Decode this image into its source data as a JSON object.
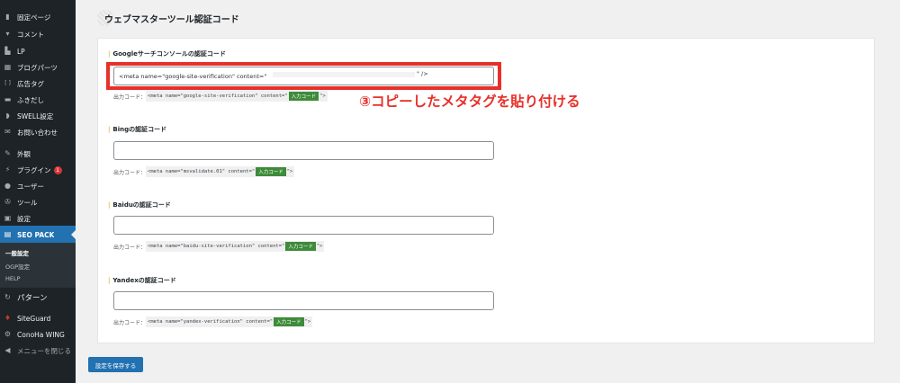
{
  "sidebar": {
    "items": [
      {
        "label": "固定ページ",
        "icon": "page-icon"
      },
      {
        "label": "コメント",
        "icon": "comment-icon"
      },
      {
        "label": "LP",
        "icon": "document-icon"
      },
      {
        "label": "ブログパーツ",
        "icon": "blocks-icon"
      },
      {
        "label": "広告タグ",
        "icon": "ad-tag-icon"
      },
      {
        "label": "ふきだし",
        "icon": "speech-bubble-icon"
      },
      {
        "label": "SWELL設定",
        "icon": "swell-icon"
      },
      {
        "label": "お問い合わせ",
        "icon": "mail-icon"
      },
      {
        "label": "外観",
        "icon": "appearance-icon"
      },
      {
        "label": "プラグイン",
        "icon": "plugin-icon",
        "badge": "1"
      },
      {
        "label": "ユーザー",
        "icon": "user-icon"
      },
      {
        "label": "ツール",
        "icon": "tools-icon"
      },
      {
        "label": "設定",
        "icon": "settings-icon"
      },
      {
        "label": "SEO PACK",
        "icon": "seo-pack-icon",
        "current": true
      },
      {
        "label": "パターン",
        "icon": "pattern-icon"
      },
      {
        "label": "SiteGuard",
        "icon": "siteguard-icon"
      },
      {
        "label": "ConoHa WING",
        "icon": "gear-icon"
      },
      {
        "label": "メニューを閉じる",
        "icon": "collapse-icon"
      }
    ],
    "submenu": [
      {
        "label": "一般設定",
        "active": true
      },
      {
        "label": "OGP設定"
      },
      {
        "label": "HELP"
      }
    ]
  },
  "page": {
    "title": "ウェブマスターツール認証コード"
  },
  "fields": [
    {
      "label": "Googleサーチコンソールの認証コード",
      "value": "<meta name=\"google-site-verification\" content=\"",
      "value_suffix": "\" />",
      "output_prefix": "出力コード：",
      "code_before": "<meta name=\"google-site-verification\" content=\"",
      "code_input": "入力コード",
      "code_after": "\">"
    },
    {
      "label": "Bingの認証コード",
      "value": "",
      "output_prefix": "出力コード：",
      "code_before": "<meta name=\"msvalidate.01\" content=\"",
      "code_input": "入力コード",
      "code_after": "\">"
    },
    {
      "label": "Baiduの認証コード",
      "value": "",
      "output_prefix": "出力コード：",
      "code_before": "<meta name=\"baidu-site-verification\" content=\"",
      "code_input": "入力コード",
      "code_after": "\">"
    },
    {
      "label": "Yandexの認証コード",
      "value": "",
      "output_prefix": "出力コード：",
      "code_before": "<meta name=\"yandex-verification\" content=\"",
      "code_input": "入力コード",
      "code_after": "\">"
    }
  ],
  "annotation": "③コピーしたメタタグを貼り付ける",
  "save_button": "設定を保存する",
  "colors": {
    "sidebar_bg": "#1d2327",
    "accent": "#2271b1",
    "highlight": "#e8302a",
    "input_code_badge": "#3e8b3a"
  }
}
